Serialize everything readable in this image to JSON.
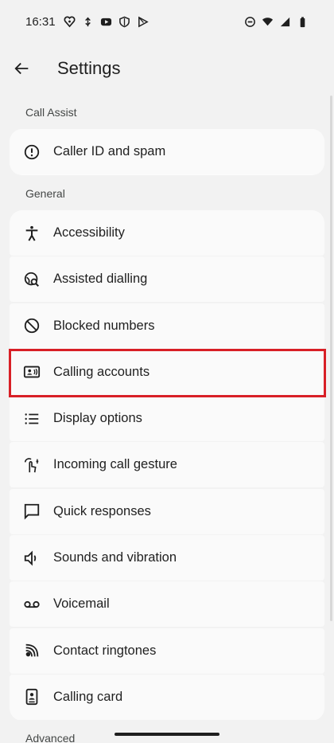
{
  "status": {
    "time": "16:31",
    "icons_left": [
      "heart-shield-icon",
      "usb-icon",
      "youtube-icon",
      "shield-icon",
      "play-store-icon"
    ],
    "icons_right": [
      "dnd-icon",
      "wifi-icon",
      "signal-icon",
      "battery-icon"
    ]
  },
  "app_bar": {
    "title": "Settings"
  },
  "sections": [
    {
      "header": "Call Assist",
      "items": [
        {
          "label": "Caller ID and spam",
          "icon": "alert-circle-icon"
        }
      ]
    },
    {
      "header": "General",
      "items": [
        {
          "label": "Accessibility",
          "icon": "accessibility-icon"
        },
        {
          "label": "Assisted dialling",
          "icon": "globe-search-icon"
        },
        {
          "label": "Blocked numbers",
          "icon": "block-icon"
        },
        {
          "label": "Calling accounts",
          "icon": "contact-card-icon"
        },
        {
          "label": "Display options",
          "icon": "list-icon"
        },
        {
          "label": "Incoming call gesture",
          "icon": "gesture-icon"
        },
        {
          "label": "Quick responses",
          "icon": "chat-icon"
        },
        {
          "label": "Sounds and vibration",
          "icon": "volume-icon"
        },
        {
          "label": "Voicemail",
          "icon": "voicemail-icon"
        },
        {
          "label": "Contact ringtones",
          "icon": "ringtone-icon"
        },
        {
          "label": "Calling card",
          "icon": "calling-card-icon"
        }
      ]
    },
    {
      "header": "Advanced"
    }
  ],
  "highlight_color": "#d81f26"
}
